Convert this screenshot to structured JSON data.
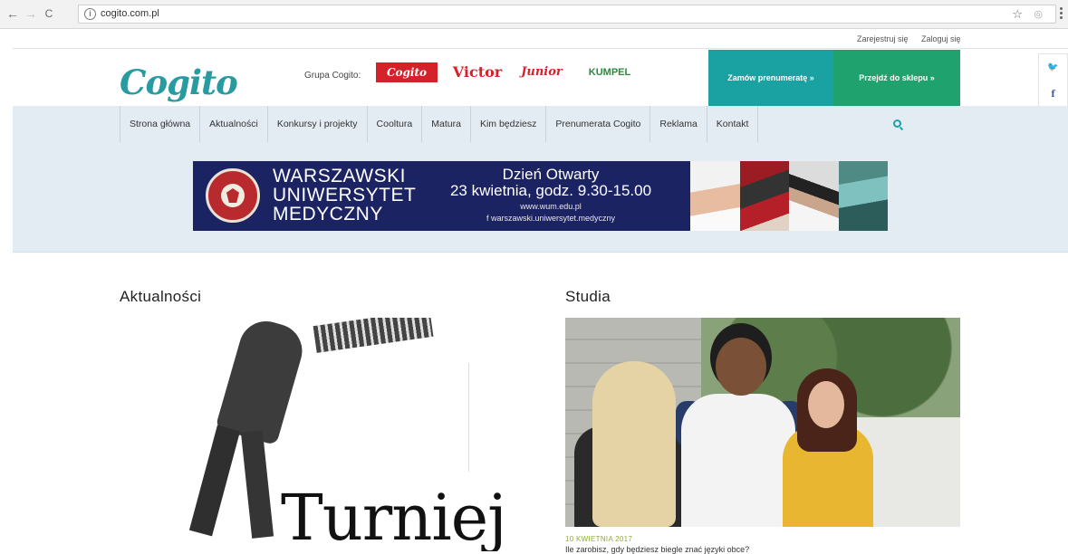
{
  "browser": {
    "url": "cogito.com.pl",
    "back_label": "←",
    "forward_label": "→",
    "reload_label": "C"
  },
  "topbar": {
    "register": "Zarejestruj się",
    "login": "Zaloguj się"
  },
  "header": {
    "logo": "Cogito",
    "group_label": "Grupa Cogito:",
    "brands": [
      "Cogito",
      "Victor",
      "Junior",
      "KUMPEL"
    ],
    "subscribe_cta": "Zamów prenumeratę »",
    "shop_cta": "Przejdź do sklepu »",
    "colors": {
      "teal": "#1aa2a2",
      "green": "#1fa26e",
      "band": "#e3ebf3",
      "brand_red": "#d5212a"
    }
  },
  "social": {
    "twitter": "🐦",
    "facebook": "f",
    "instagram": "◙"
  },
  "nav": {
    "items": [
      "Strona główna",
      "Aktualności",
      "Konkursy i projekty",
      "Cooltura",
      "Matura",
      "Kim będziesz",
      "Prenumerata Cogito",
      "Reklama",
      "Kontakt"
    ]
  },
  "banner": {
    "org_line1": "WARSZAWSKI",
    "org_line2": "UNIWERSYTET",
    "org_line3": "MEDYCZNY",
    "event_title": "Dzień Otwarty",
    "event_date": "23 kwietnia, godz. 9.30-15.00",
    "event_url": "www.wum.edu.pl",
    "event_fb": "f  warszawski.uniwersytet.medyczny"
  },
  "news": {
    "section_title": "Aktualności",
    "headline": "Turniej"
  },
  "studies": {
    "section_title": "Studia",
    "date": "10 KWIETNIA 2017",
    "title": "Ile zarobisz, gdy będziesz biegle znać języki obce?"
  }
}
